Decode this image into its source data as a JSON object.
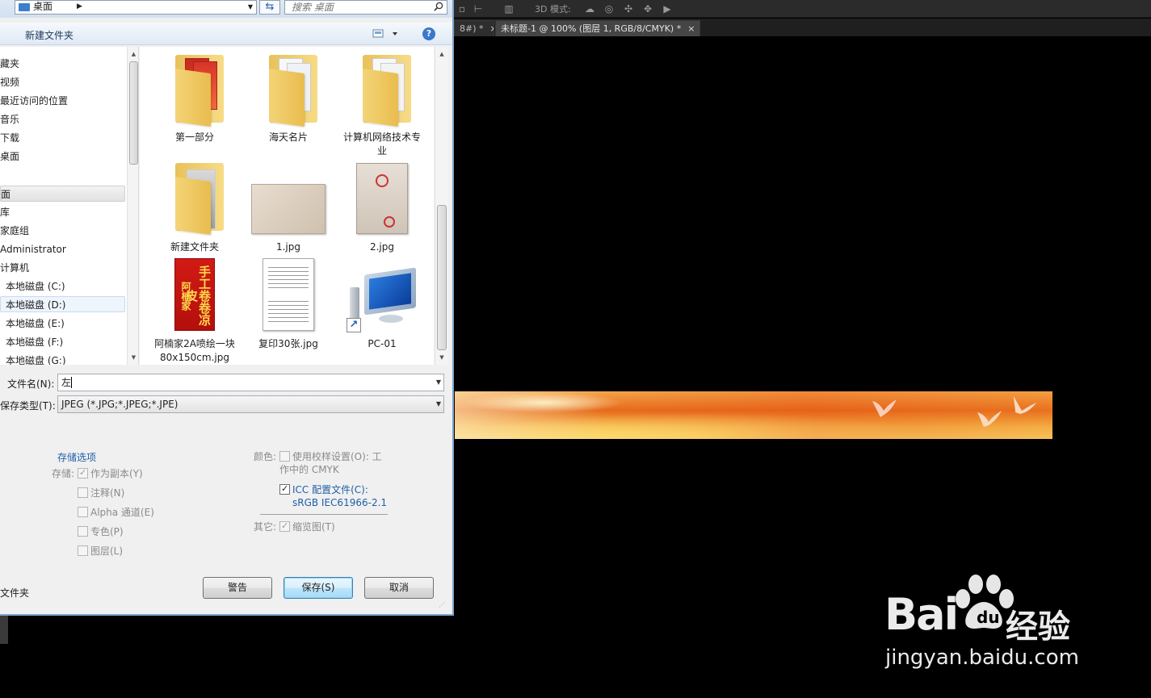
{
  "address_bar": {
    "path": "桌面",
    "search_placeholder": "搜索 桌面"
  },
  "toolbar": {
    "new_folder": "新建文件夹",
    "help": "?"
  },
  "nav": {
    "items": [
      "藏夹",
      "视频",
      "最近访问的位置",
      "音乐",
      "下载",
      "桌面",
      "面",
      "库",
      "家庭组",
      "Administrator",
      "计算机",
      "本地磁盘 (C:)",
      "本地磁盘 (D:)",
      "本地磁盘 (E:)",
      "本地磁盘 (F:)",
      "本地磁盘 (G:)"
    ]
  },
  "files": [
    {
      "name": "第一部分",
      "type": "folder"
    },
    {
      "name": "海天名片",
      "type": "folder"
    },
    {
      "name": "计算机网络技术专业",
      "type": "folder"
    },
    {
      "name": "新建文件夹",
      "type": "folder"
    },
    {
      "name": "1.jpg",
      "type": "image"
    },
    {
      "name": "2.jpg",
      "type": "image"
    },
    {
      "name": "阿楠家2A喷绘一块80x150cm.jpg",
      "type": "image"
    },
    {
      "name": "复印30张.jpg",
      "type": "image"
    },
    {
      "name": "PC-01",
      "type": "shortcut"
    }
  ],
  "form": {
    "filename_label": "文件名(N):",
    "filename_value": "左",
    "filetype_label": "保存类型(T):",
    "filetype_value": "JPEG (*.JPG;*.JPEG;*.JPE)"
  },
  "options": {
    "title": "存储选项",
    "save_label": "存储:",
    "as_copy": "作为副本(Y)",
    "notes": "注释(N)",
    "alpha": "Alpha 通道(E)",
    "spot": "专色(P)",
    "layers": "图层(L)",
    "color_label": "颜色:",
    "use_proof": "使用校样设置(O): 工作中的 CMYK",
    "icc_profile": "ICC 配置文件(C):",
    "icc_value": "sRGB IEC61966-2.1",
    "other_label": "其它:",
    "thumbnail": "缩览图(T)"
  },
  "buttons": {
    "warning": "警告",
    "save": "保存(S)",
    "cancel": "取消"
  },
  "hide_folders": "文件夹",
  "photoshop": {
    "options_3d_label": "3D 模式:",
    "tab1": "8#) *",
    "tab2": "未标题-1 @ 100% (图层 1, RGB/8/CMYK) *"
  },
  "watermark": {
    "brand": "Bai",
    "brand2": "经验",
    "url": "jingyan.baidu.com"
  }
}
